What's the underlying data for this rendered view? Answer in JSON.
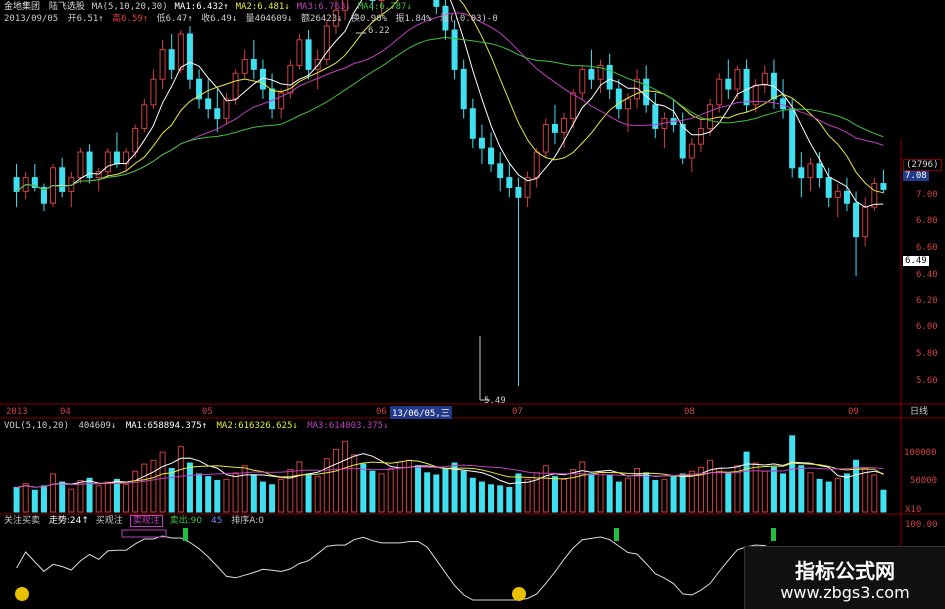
{
  "header": {
    "stock_name": "金地集团",
    "indicator_name": "陆飞选股",
    "ma_params": "MA(5,10,20,30)",
    "ma1": "MA1:6.432↑",
    "ma2": "MA2:6.481↓",
    "ma3": "MA3:6.763↓",
    "ma4": "MA4:6.787↓",
    "date": "2013/09/05",
    "open": "开6.51↑",
    "high": "高6.59↑",
    "low": "低6.47↑",
    "close": "收6.49↓",
    "volume": "量404609↓",
    "amount": "额26423↓",
    "turnover": "换0.90%",
    "amplitude": "振1.84%",
    "change": "涨(-0.03)-0"
  },
  "price_axis": {
    "ticks": [
      "7.00",
      "6.80",
      "6.60",
      "6.40",
      "6.20",
      "6.00",
      "5.80",
      "5.60"
    ],
    "badge_top": "(2796)",
    "badge_price": "7.08",
    "current_price": "6.49"
  },
  "annotations": {
    "high_mark": "6.22",
    "low_mark": "5.49"
  },
  "time_axis": {
    "labels": [
      "2013",
      "04",
      "05",
      "06",
      "07",
      "08",
      "09"
    ],
    "cursor_date": "13/06/05,三",
    "period": "日线"
  },
  "volume_panel": {
    "title": "VOL(5,10,20)",
    "value": "404609↓",
    "ma1": "MA1:658894.375↑",
    "ma2": "MA2:616326.625↓",
    "ma3": "MA3:614003.375↓",
    "ticks": [
      "100000",
      "50000"
    ],
    "unit": "X10"
  },
  "indicator_panel": {
    "title": "关注买卖",
    "trend": "走势:24↑",
    "buy": "买观注",
    "sell_watch": "卖观注",
    "sell_out": "卖出:90",
    "num": "45",
    "sort": "排序A:0",
    "tick": "100.00"
  },
  "watermark": {
    "title": "指标公式网",
    "url": "www.zbgs3.com"
  },
  "colors": {
    "up": "#d04040",
    "down": "#40e0f0",
    "ma1": "#ffffff",
    "ma2": "#e8e840",
    "ma3": "#c040c0",
    "ma4": "#40c040"
  },
  "chart_data": {
    "type": "candlestick",
    "price_ylim": [
      5.4,
      7.3
    ],
    "candles": [
      [
        6.55,
        6.62,
        6.4,
        6.48
      ],
      [
        6.48,
        6.58,
        6.44,
        6.55
      ],
      [
        6.55,
        6.62,
        6.48,
        6.5
      ],
      [
        6.5,
        6.52,
        6.38,
        6.42
      ],
      [
        6.42,
        6.62,
        6.4,
        6.6
      ],
      [
        6.6,
        6.65,
        6.45,
        6.48
      ],
      [
        6.48,
        6.58,
        6.4,
        6.55
      ],
      [
        6.55,
        6.7,
        6.52,
        6.68
      ],
      [
        6.68,
        6.72,
        6.52,
        6.55
      ],
      [
        6.55,
        6.6,
        6.48,
        6.58
      ],
      [
        6.58,
        6.7,
        6.55,
        6.68
      ],
      [
        6.68,
        6.78,
        6.6,
        6.62
      ],
      [
        6.62,
        6.7,
        6.58,
        6.68
      ],
      [
        6.68,
        6.82,
        6.65,
        6.8
      ],
      [
        6.8,
        6.95,
        6.78,
        6.92
      ],
      [
        6.92,
        7.1,
        6.9,
        7.05
      ],
      [
        7.05,
        7.25,
        7.0,
        7.2
      ],
      [
        7.2,
        7.28,
        7.05,
        7.1
      ],
      [
        7.1,
        7.3,
        7.08,
        7.28
      ],
      [
        7.28,
        7.32,
        7.0,
        7.05
      ],
      [
        7.05,
        7.1,
        6.9,
        6.95
      ],
      [
        6.95,
        7.05,
        6.85,
        6.9
      ],
      [
        6.9,
        7.0,
        6.78,
        6.85
      ],
      [
        6.85,
        6.98,
        6.82,
        6.95
      ],
      [
        6.95,
        7.1,
        6.92,
        7.08
      ],
      [
        7.08,
        7.2,
        7.05,
        7.15
      ],
      [
        7.15,
        7.25,
        7.05,
        7.1
      ],
      [
        7.1,
        7.15,
        6.95,
        7.0
      ],
      [
        7.0,
        7.08,
        6.85,
        6.9
      ],
      [
        6.9,
        7.0,
        6.85,
        6.98
      ],
      [
        6.98,
        7.15,
        6.95,
        7.12
      ],
      [
        7.12,
        7.28,
        7.1,
        7.25
      ],
      [
        7.25,
        7.3,
        7.05,
        7.1
      ],
      [
        7.1,
        7.2,
        7.0,
        7.15
      ],
      [
        7.15,
        7.35,
        7.12,
        7.32
      ],
      [
        7.32,
        7.45,
        7.28,
        7.4
      ],
      [
        7.4,
        7.55,
        7.35,
        7.5
      ],
      [
        7.5,
        7.65,
        7.45,
        7.58
      ],
      [
        7.58,
        7.7,
        7.48,
        7.52
      ],
      [
        7.52,
        7.6,
        7.4,
        7.45
      ],
      [
        7.45,
        7.55,
        7.38,
        7.5
      ],
      [
        7.5,
        7.62,
        7.46,
        7.58
      ],
      [
        7.58,
        7.68,
        7.5,
        7.62
      ],
      [
        7.62,
        7.75,
        7.55,
        7.7
      ],
      [
        7.7,
        7.8,
        7.58,
        7.62
      ],
      [
        7.62,
        7.72,
        7.5,
        7.55
      ],
      [
        7.55,
        7.6,
        7.38,
        7.42
      ],
      [
        7.42,
        7.5,
        7.25,
        7.3
      ],
      [
        7.3,
        7.35,
        7.05,
        7.1
      ],
      [
        7.1,
        7.15,
        6.85,
        6.9
      ],
      [
        6.9,
        6.95,
        6.7,
        6.75
      ],
      [
        6.75,
        6.82,
        6.62,
        6.7
      ],
      [
        6.7,
        6.78,
        6.58,
        6.62
      ],
      [
        6.62,
        6.68,
        6.48,
        6.55
      ],
      [
        6.55,
        6.62,
        6.45,
        6.5
      ],
      [
        6.5,
        6.55,
        5.49,
        6.45
      ],
      [
        6.45,
        6.58,
        6.4,
        6.55
      ],
      [
        6.55,
        6.7,
        6.5,
        6.68
      ],
      [
        6.68,
        6.85,
        6.65,
        6.82
      ],
      [
        6.82,
        6.92,
        6.72,
        6.78
      ],
      [
        6.78,
        6.88,
        6.7,
        6.85
      ],
      [
        6.85,
        7.0,
        6.8,
        6.98
      ],
      [
        6.98,
        7.12,
        6.95,
        7.1
      ],
      [
        7.1,
        7.2,
        7.0,
        7.05
      ],
      [
        7.05,
        7.15,
        6.98,
        7.12
      ],
      [
        7.12,
        7.18,
        6.95,
        7.0
      ],
      [
        7.0,
        7.05,
        6.85,
        6.9
      ],
      [
        6.9,
        6.98,
        6.78,
        6.95
      ],
      [
        6.95,
        7.1,
        6.9,
        7.05
      ],
      [
        7.05,
        7.12,
        6.88,
        6.92
      ],
      [
        6.92,
        6.98,
        6.75,
        6.8
      ],
      [
        6.8,
        6.88,
        6.7,
        6.85
      ],
      [
        6.85,
        6.95,
        6.78,
        6.82
      ],
      [
        6.82,
        6.88,
        6.62,
        6.65
      ],
      [
        6.65,
        6.75,
        6.58,
        6.72
      ],
      [
        6.72,
        6.85,
        6.68,
        6.8
      ],
      [
        6.8,
        6.95,
        6.76,
        6.92
      ],
      [
        6.92,
        7.08,
        6.88,
        7.05
      ],
      [
        7.05,
        7.15,
        6.95,
        7.0
      ],
      [
        7.0,
        7.12,
        6.95,
        7.1
      ],
      [
        7.1,
        7.15,
        6.88,
        6.92
      ],
      [
        6.92,
        7.05,
        6.88,
        7.02
      ],
      [
        7.02,
        7.12,
        6.98,
        7.08
      ],
      [
        7.08,
        7.15,
        6.9,
        6.95
      ],
      [
        6.95,
        7.05,
        6.85,
        6.9
      ],
      [
        6.9,
        6.95,
        6.55,
        6.6
      ],
      [
        6.6,
        6.68,
        6.45,
        6.55
      ],
      [
        6.55,
        6.65,
        6.48,
        6.62
      ],
      [
        6.62,
        6.68,
        6.5,
        6.55
      ],
      [
        6.55,
        6.6,
        6.4,
        6.45
      ],
      [
        6.45,
        6.52,
        6.35,
        6.48
      ],
      [
        6.48,
        6.55,
        6.38,
        6.42
      ],
      [
        6.42,
        6.48,
        6.05,
        6.25
      ],
      [
        6.25,
        6.45,
        6.2,
        6.4
      ],
      [
        6.4,
        6.55,
        6.38,
        6.52
      ],
      [
        6.52,
        6.59,
        6.47,
        6.49
      ]
    ],
    "volumes": [
      45,
      52,
      40,
      48,
      70,
      55,
      42,
      58,
      62,
      48,
      55,
      60,
      50,
      75,
      88,
      95,
      110,
      80,
      120,
      90,
      70,
      65,
      58,
      60,
      72,
      85,
      68,
      55,
      50,
      60,
      78,
      92,
      70,
      65,
      98,
      115,
      130,
      105,
      88,
      75,
      70,
      80,
      92,
      95,
      85,
      72,
      68,
      80,
      90,
      75,
      62,
      55,
      50,
      48,
      45,
      70,
      60,
      72,
      85,
      65,
      60,
      78,
      92,
      70,
      75,
      68,
      55,
      62,
      80,
      72,
      58,
      60,
      65,
      70,
      75,
      82,
      95,
      80,
      72,
      85,
      110,
      90,
      75,
      82,
      70,
      140,
      85,
      72,
      60,
      55,
      62,
      70,
      95,
      80,
      68,
      40
    ]
  }
}
